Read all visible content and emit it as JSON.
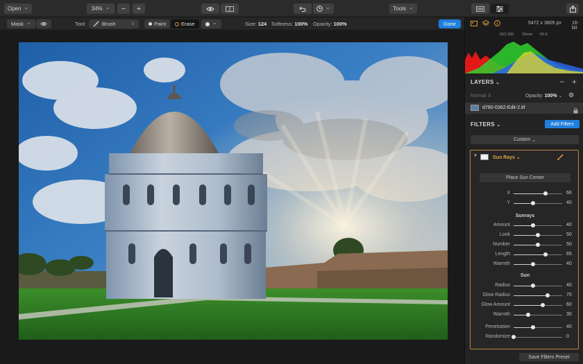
{
  "topbar": {
    "open_label": "Open",
    "zoom_label": "34%",
    "minus_label": "−",
    "plus_label": "+",
    "tools_label": "Tools"
  },
  "toolbar2": {
    "mask_label": "Mask",
    "tool_prefix": "Tool:",
    "tool_value": "Brush",
    "paint_label": "Paint",
    "erase_label": "Erase",
    "size_label": "Size:",
    "size_value": "124",
    "softness_label": "Softness:",
    "softness_value": "100%",
    "opacity_label": "Opacity:",
    "opacity_value": "100%",
    "done_label": "Done"
  },
  "info": {
    "dimensions": "5472 x 3805 px",
    "bitdepth": "16-bit",
    "iso": "ISO 200",
    "focal": "15mm",
    "aperture": "f/5.6"
  },
  "layers": {
    "title": "LAYERS",
    "blend_mode": "Normal",
    "opacity_label": "Opacity:",
    "opacity_value": "100%",
    "layer_name": "d780-0362-Edit-2.tif"
  },
  "filters": {
    "title": "FILTERS",
    "add_label": "Add Filters",
    "preset": "Custom",
    "filter_name": "Sun Rays",
    "place_sun_label": "Place Sun Center",
    "save_preset_label": "Save Filters Preset",
    "position": [
      {
        "label": "X",
        "value": 66
      },
      {
        "label": "Y",
        "value": 40
      }
    ],
    "sunrays_title": "Sunrays",
    "sunrays": [
      {
        "label": "Amount",
        "value": 40
      },
      {
        "label": "Look",
        "value": 50
      },
      {
        "label": "Number",
        "value": 50
      },
      {
        "label": "Length",
        "value": 65
      },
      {
        "label": "Warmth",
        "value": 40
      }
    ],
    "sun_title": "Sun",
    "sun": [
      {
        "label": "Radius",
        "value": 40
      },
      {
        "label": "Glow Radius",
        "value": 70
      },
      {
        "label": "Glow Amount",
        "value": 60
      },
      {
        "label": "Warmth",
        "value": 30
      }
    ],
    "other": [
      {
        "label": "Penetration",
        "value": 40
      },
      {
        "label": "Randomize",
        "value": 0
      }
    ]
  },
  "colors": {
    "accent_blue": "#1f7fdc",
    "filter_border": "#b98a3c",
    "filter_name": "#e0a640"
  }
}
